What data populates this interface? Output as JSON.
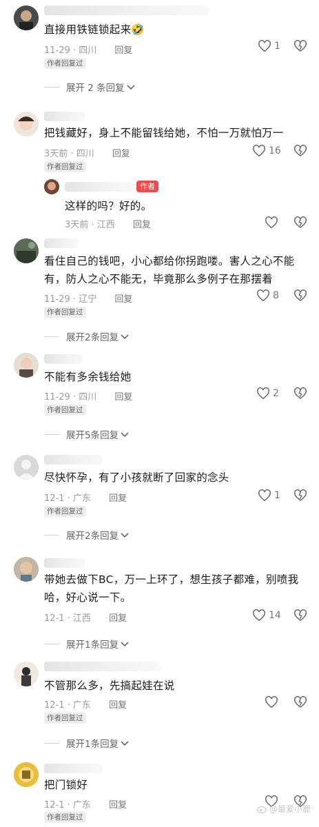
{
  "colors": {
    "text": "#1b1b1b",
    "meta": "#9b9b9b",
    "author_badge": "#f04a4a"
  },
  "comments": [
    {
      "text": "直接用铁链锁起来🤣",
      "date": "11-29",
      "location": "四川",
      "reply_label": "回复",
      "author_replied": "作者回复过",
      "likes": "1",
      "expand": "展开 2 条回复"
    },
    {
      "text": "把钱藏好，身上不能留钱给她，不怕一万就怕万一",
      "date": "3天前",
      "location": "四川",
      "reply_label": "回复",
      "author_replied": "作者回复过",
      "likes": "16",
      "reply": {
        "badge": "作者",
        "text": "这样的吗？好的。",
        "date": "3天前",
        "location": "江西",
        "reply_label": "回复"
      }
    },
    {
      "text_line1": "看住自己的钱吧，小心都给你拐跑喽。害人之心不能",
      "text_line2": "有，防人之心不能无，毕竟那么多例子在那摆着",
      "date": "11-29",
      "location": "辽宁",
      "reply_label": "回复",
      "author_replied": "作者回复过",
      "likes": "8",
      "expand": "展开2条回复"
    },
    {
      "text": "不能有多余钱给她",
      "date": "11-29",
      "location": "四川",
      "reply_label": "回复",
      "author_replied": "作者回复过",
      "likes": "2",
      "expand": "展开5条回复"
    },
    {
      "text": "尽快怀孕，有了小孩就断了回家的念头",
      "date": "12-1",
      "location": "广东",
      "reply_label": "回复",
      "author_replied": "作者回复过",
      "likes": "1",
      "expand": "展开2条回复"
    },
    {
      "text_line1": "带她去做下BC，万一上环了，想生孩子都难，别喷我",
      "text_line2": "哈，好心说一下。",
      "date": "12-1",
      "location": "江西",
      "reply_label": "回复",
      "likes": "14",
      "expand": "展开1条回复"
    },
    {
      "text": "不管那么多，先搞起娃在说",
      "date": "12-1",
      "location": "广东",
      "reply_label": "回复",
      "author_replied": "作者回复过",
      "expand": "展开1条回复"
    },
    {
      "text": "把门锁好",
      "date": "12-1",
      "location": "广东",
      "reply_label": "回复",
      "author_replied": "作者回复过"
    }
  ],
  "watermark": "@最爱小鹿"
}
